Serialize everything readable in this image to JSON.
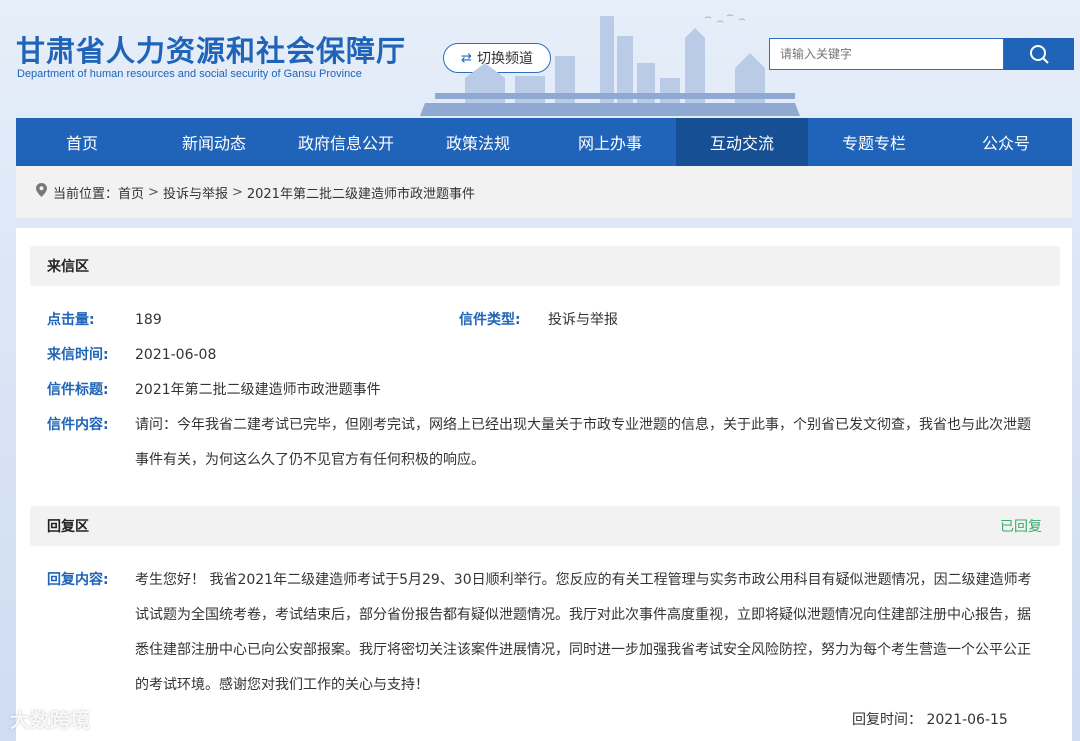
{
  "header": {
    "title_cn": "甘肃省人力资源和社会保障厅",
    "title_en": "Department of human resources and social security of Gansu Province",
    "switch_label": "切换频道",
    "search_placeholder": "请输入关键字"
  },
  "nav": {
    "items": [
      "首页",
      "新闻动态",
      "政府信息公开",
      "政策法规",
      "网上办事",
      "互动交流",
      "专题专栏",
      "公众号"
    ],
    "active_index": 5
  },
  "breadcrumb": {
    "prefix": "当前位置：",
    "items": [
      "首页",
      "投诉与举报",
      "2021年第二批二级建造师市政泄题事件"
    ],
    "separator": ">"
  },
  "letter": {
    "section_title": "来信区",
    "clicks_label": "点击量:",
    "clicks_value": "189",
    "type_label": "信件类型:",
    "type_value": "投诉与举报",
    "time_label": "来信时间:",
    "time_value": "2021-06-08",
    "subject_label": "信件标题:",
    "subject_value": "2021年第二批二级建造师市政泄题事件",
    "content_label": "信件内容:",
    "content_line1": "请问：今年我省二建考试已完毕，但刚考完试，网络上已经出现大量关于市政专业泄题的信息，关于此事，个别省已发文彻查，我省也与此次泄题",
    "content_line2": "事件有关，为何这么久了仍不见官方有任何积极的响应。"
  },
  "reply": {
    "section_title": "回复区",
    "status": "已回复",
    "content_label": "回复内容:",
    "line1": "考生您好！ 我省2021年二级建造师考试于5月29、30日顺利举行。您反应的有关工程管理与实务市政公用科目有疑似泄题情况，因二级建造师考",
    "line2": "试试题为全国统考卷，考试结束后，部分省份报告都有疑似泄题情况。我厅对此次事件高度重视，立即将疑似泄题情况向住建部注册中心报告，据",
    "line3": "悉住建部注册中心已向公安部报案。我厅将密切关注该案件进展情况，同时进一步加强我省考试安全风险防控，努力为每个考生营造一个公平公正",
    "line4": "的考试环境。感谢您对我们工作的关心与支持！",
    "time_text": "回复时间：  2021-06-15"
  },
  "watermark": "大数跨境",
  "colors": {
    "brand": "#1f64b8",
    "nav_active": "#174f95",
    "replied": "#3aaa70"
  }
}
